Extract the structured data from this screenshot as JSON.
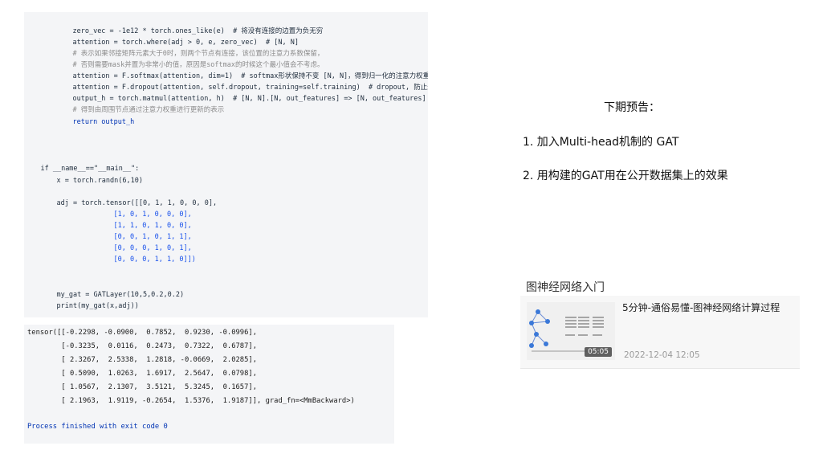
{
  "code": {
    "lines": [
      "zero_vec = -1e12 * torch.ones_like(e)  # 将没有连接的边置为负无穷",
      "attention = torch.where(adj > 0, e, zero_vec)  # [N, N]",
      "# 表示如果邻接矩阵元素大于0时，则两个节点有连接，该位置的注意力系数保留，",
      "# 否则需要mask并置为非常小的值，原因是softmax的时候这个最小值会不考虑。",
      "attention = F.softmax(attention, dim=1)  # softmax形状保持不变 [N, N]，得到归一化的注意力权重!",
      "attention = F.dropout(attention, self.dropout, training=self.training)  # dropout, 防止过拟合",
      "output_h = torch.matmul(attention, h)  # [N, N].[N, out_features] => [N, out_features]",
      "# 得到由周围节点通过注意力权重进行更新的表示",
      "return output_h",
      "if __name__==\"__main__\":",
      "x = torch.randn(6,10)",
      "adj = torch.tensor([[0, 1, 1, 0, 0, 0],",
      "[1, 0, 1, 0, 0, 0],",
      "[1, 1, 0, 1, 0, 0],",
      "[0, 0, 1, 0, 1, 1],",
      "[0, 0, 0, 1, 0, 1],",
      "[0, 0, 0, 1, 1, 0]])",
      "my_gat = GATLayer(10,5,0.2,0.2)",
      "print(my_gat(x,adj))"
    ]
  },
  "console": {
    "lines": [
      "tensor([[-0.2298, -0.0900,  0.7852,  0.9230, -0.0996],",
      "        [-0.3235,  0.0116,  0.2473,  0.7322,  0.6787],",
      "        [ 2.3267,  2.5338,  1.2818, -0.0669,  2.0285],",
      "        [ 0.5090,  1.0263,  1.6917,  2.5647,  0.0798],",
      "        [ 1.0567,  2.1307,  3.5121,  5.3245,  0.1657],",
      "        [ 2.1963,  1.9119, -0.2654,  1.5376,  1.9187]], grad_fn=<MmBackward>)"
    ],
    "exit": "Process finished with exit code 0"
  },
  "preview": {
    "title": "下期预告：",
    "items": [
      "1.        加入Multi-head机制的 GAT",
      "2.  用构建的GAT用在公开数据集上的效果"
    ]
  },
  "card": {
    "heading": "图神经网络入门",
    "video_title": "5分钟-通俗易懂-图神经网络计算过程",
    "duration": "05:05",
    "date": "2022-12-04 12:05"
  }
}
